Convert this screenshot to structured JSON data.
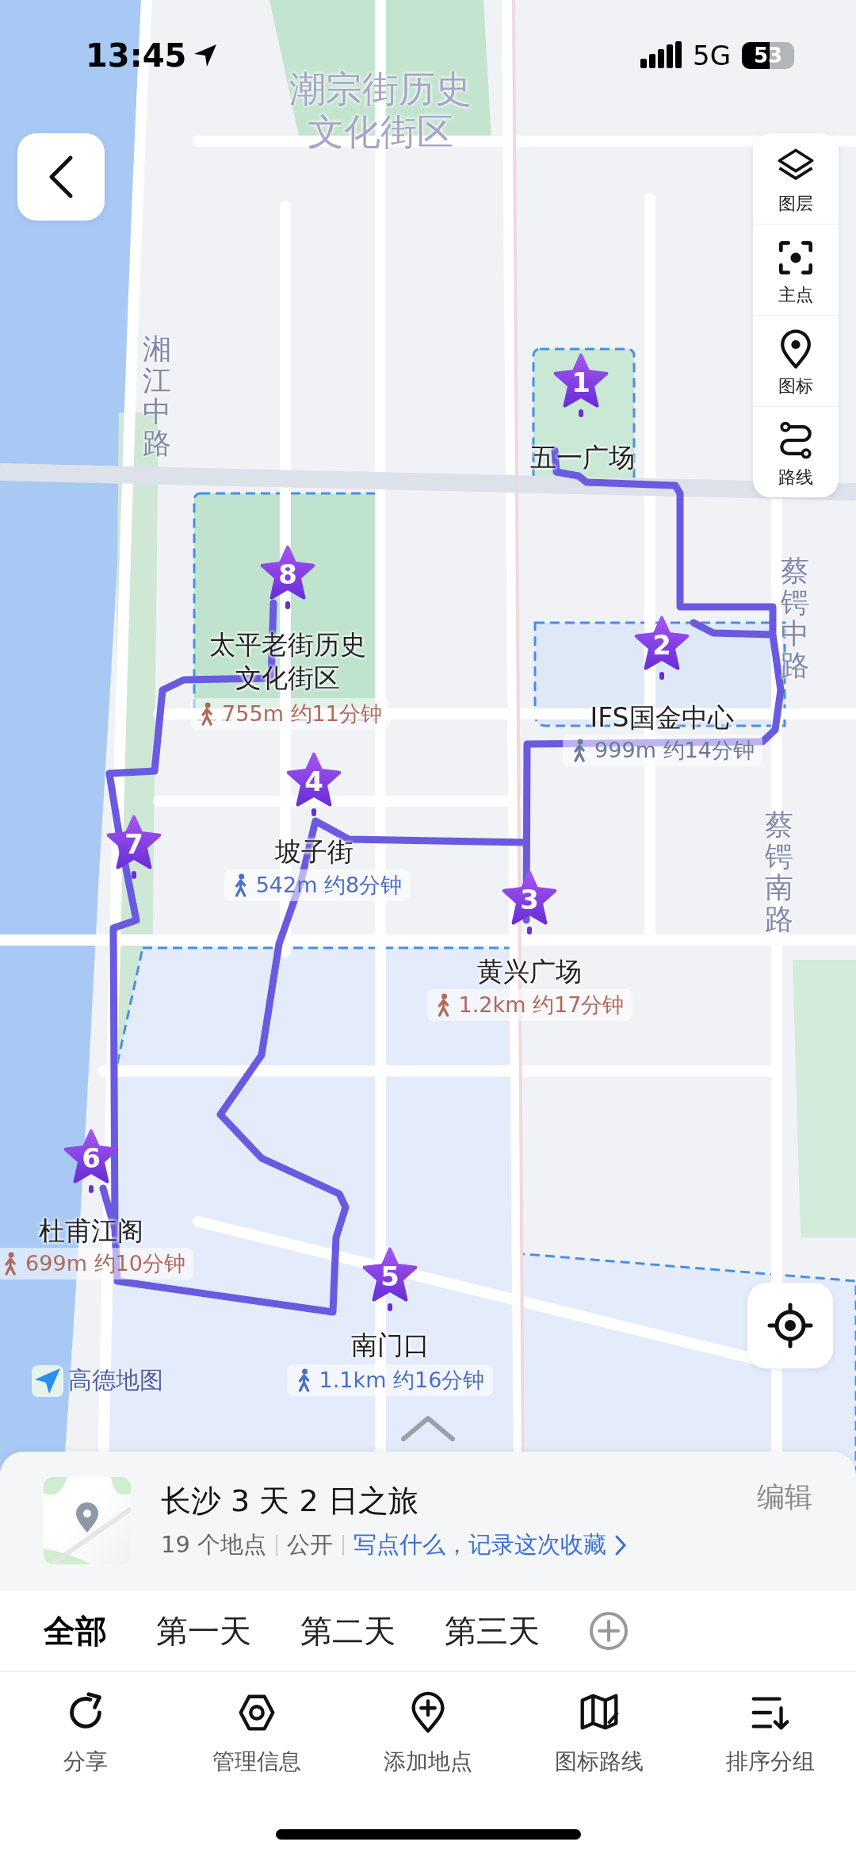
{
  "status_bar": {
    "time": "13:45",
    "network": "5G",
    "battery": "53"
  },
  "map": {
    "area_labels": [
      {
        "text": "潮宗街历史文化街区",
        "kind": "district"
      },
      {
        "text": "湘江中路",
        "kind": "road"
      },
      {
        "text": "蔡锷中路",
        "kind": "road"
      },
      {
        "text": "蔡锷南路",
        "kind": "road"
      }
    ],
    "pois": [
      {
        "number": "1",
        "name": "五一广场"
      },
      {
        "number": "2",
        "name": "IFS国金中心",
        "walk": {
          "text": "999m 约14分钟",
          "color": "#6b7a99"
        }
      },
      {
        "number": "3",
        "name": "黄兴广场",
        "walk": {
          "text": "1.2km 约17分钟",
          "color": "#b0695a"
        }
      },
      {
        "number": "4",
        "name": "坡子街",
        "walk": {
          "text": "542m 约8分钟",
          "color": "#4a6fc4"
        }
      },
      {
        "number": "5",
        "name": "南门口",
        "walk": {
          "text": "1.1km 约16分钟",
          "color": "#4a6fc4"
        }
      },
      {
        "number": "6",
        "name": "杜甫江阁",
        "walk": {
          "text": "699m 约10分钟",
          "color": "#b0695a"
        }
      },
      {
        "number": "7"
      },
      {
        "number": "8",
        "name": "太平老街历史文化街区",
        "walk": {
          "text": "755m 约11分钟",
          "color": "#b0695a"
        }
      }
    ],
    "toolbar": [
      {
        "label": "图层",
        "kind": "layers"
      },
      {
        "label": "主点",
        "kind": "focus"
      },
      {
        "label": "图标",
        "kind": "pin"
      },
      {
        "label": "路线",
        "kind": "route"
      }
    ],
    "logo": "高德地图"
  },
  "panel": {
    "title": "长沙 3 天 2 日之旅",
    "place_count": "19 个地点",
    "visibility": "公开",
    "note_link": "写点什么，记录这次收藏",
    "edit": "编辑",
    "tabs": [
      {
        "label": "全部",
        "selected": true
      },
      {
        "label": "第一天",
        "selected": false
      },
      {
        "label": "第二天",
        "selected": false
      },
      {
        "label": "第三天",
        "selected": false
      }
    ],
    "actions": [
      {
        "label": "分享",
        "kind": "share"
      },
      {
        "label": "管理信息",
        "kind": "manage"
      },
      {
        "label": "添加地点",
        "kind": "add"
      },
      {
        "label": "图标路线",
        "kind": "map"
      },
      {
        "label": "排序分组",
        "kind": "sort"
      }
    ]
  }
}
